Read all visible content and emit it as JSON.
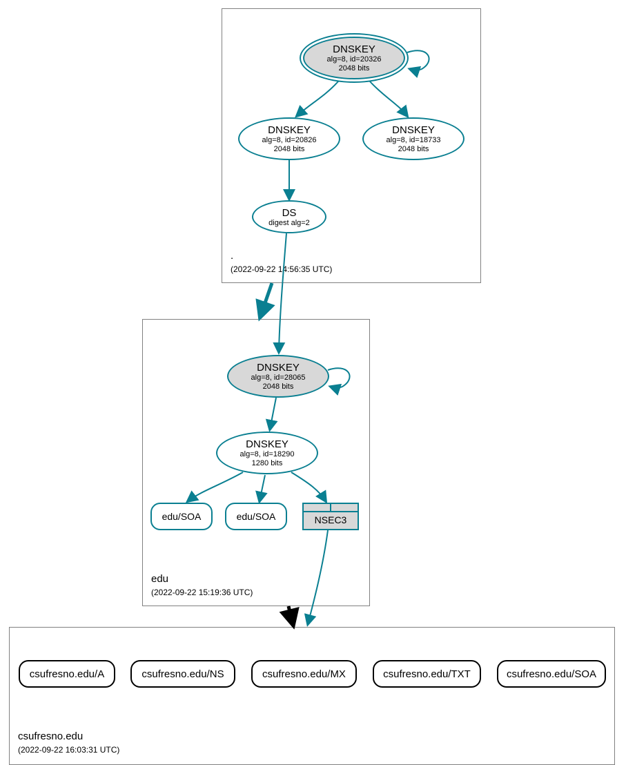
{
  "zones": {
    "root": {
      "name": ".",
      "timestamp": "(2022-09-22 14:56:35 UTC)",
      "dnskey_ksk": {
        "title": "DNSKEY",
        "line1": "alg=8, id=20326",
        "line2": "2048 bits"
      },
      "dnskey_zsk1": {
        "title": "DNSKEY",
        "line1": "alg=8, id=20826",
        "line2": "2048 bits"
      },
      "dnskey_zsk2": {
        "title": "DNSKEY",
        "line1": "alg=8, id=18733",
        "line2": "2048 bits"
      },
      "ds": {
        "title": "DS",
        "line1": "digest alg=2"
      }
    },
    "edu": {
      "name": "edu",
      "timestamp": "(2022-09-22 15:19:36 UTC)",
      "dnskey_ksk": {
        "title": "DNSKEY",
        "line1": "alg=8, id=28065",
        "line2": "2048 bits"
      },
      "dnskey_zsk": {
        "title": "DNSKEY",
        "line1": "alg=8, id=18290",
        "line2": "1280 bits"
      },
      "soa1": "edu/SOA",
      "soa2": "edu/SOA",
      "nsec3": "NSEC3"
    },
    "csufresno": {
      "name": "csufresno.edu",
      "timestamp": "(2022-09-22 16:03:31 UTC)",
      "records": {
        "a": "csufresno.edu/A",
        "ns": "csufresno.edu/NS",
        "mx": "csufresno.edu/MX",
        "txt": "csufresno.edu/TXT",
        "soa": "csufresno.edu/SOA"
      }
    }
  }
}
